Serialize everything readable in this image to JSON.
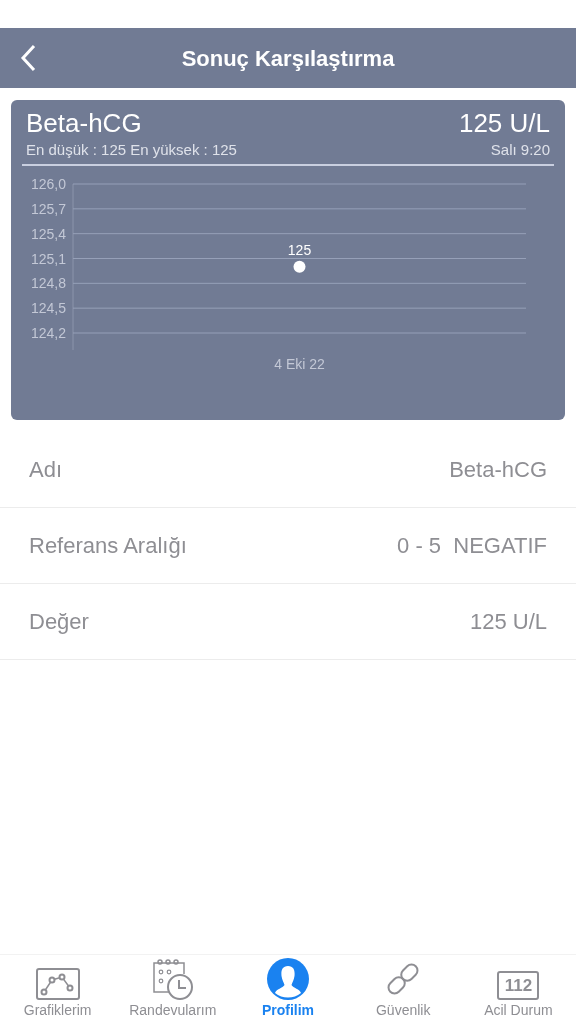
{
  "header": {
    "title": "Sonuç Karşılaştırma"
  },
  "card": {
    "test_name": "Beta-hCG",
    "value": "125 U/L",
    "range_summary": "En düşük : 125 En yüksek : 125",
    "time": "Salı 9:20",
    "chart_data": {
      "type": "scatter",
      "categories": [
        "4 Eki 22"
      ],
      "series": [
        {
          "color": "#ffffff",
          "values": [
            125
          ]
        }
      ],
      "grid": true,
      "ylim": [
        124.2,
        126.0
      ],
      "yticks": [
        {
          "value": 126.0,
          "label": "126,0"
        },
        {
          "value": 125.7,
          "label": "125,7"
        },
        {
          "value": 125.4,
          "label": "125,4"
        },
        {
          "value": 125.1,
          "label": "125,1"
        },
        {
          "value": 124.8,
          "label": "124,8"
        },
        {
          "value": 124.5,
          "label": "124,5"
        },
        {
          "value": 124.2,
          "label": "124,2"
        }
      ],
      "data_labels": true,
      "value_labels": [
        "125"
      ]
    }
  },
  "details": [
    {
      "label": "Adı",
      "value": "Beta-hCG"
    },
    {
      "label": "Referans Aralığı",
      "value": "0 - 5  NEGATIF"
    },
    {
      "label": "Değer",
      "value": "125 U/L"
    }
  ],
  "tabs": [
    {
      "label": "Grafiklerim",
      "kind": "chart",
      "selected": false
    },
    {
      "label": "Randevularım",
      "kind": "calendar",
      "selected": false
    },
    {
      "label": "Profilim",
      "kind": "profile",
      "selected": true
    },
    {
      "label": "Güvenlik",
      "kind": "link",
      "selected": false
    },
    {
      "label": "Acil Durum",
      "kind": "emergency",
      "selected": false,
      "icon_text": "112"
    }
  ]
}
